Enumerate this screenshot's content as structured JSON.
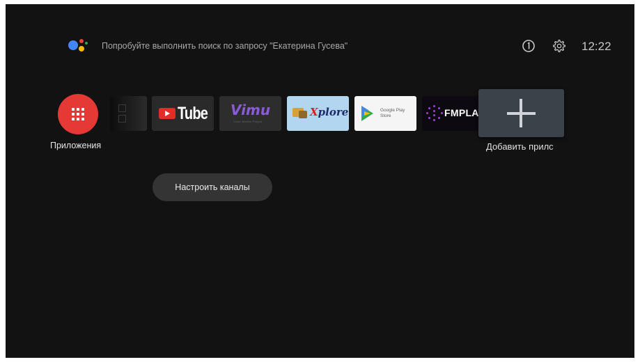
{
  "header": {
    "search_hint": "Попробуйте выполнить поиск по запросу \"Екатерина Гусева\"",
    "clock": "12:22",
    "assistant_colors": [
      "#4285f4",
      "#ea4335",
      "#fbbc05",
      "#34a853"
    ]
  },
  "apps": {
    "label": "Приложения",
    "accent": "#e53935"
  },
  "tiles": [
    {
      "id": "partial",
      "icon": "app-tile-icon"
    },
    {
      "id": "youtube",
      "text": "Tube"
    },
    {
      "id": "vimu",
      "text": "Vimu",
      "sub": "Vimu Media Player"
    },
    {
      "id": "xplore",
      "text_x": "X",
      "text_rest": "plore"
    },
    {
      "id": "play_store",
      "line1": "Google Play",
      "line2": "Store"
    },
    {
      "id": "fmplay",
      "text": "FMPLAY"
    }
  ],
  "add_app": {
    "label": "Добавить прилс"
  },
  "channels": {
    "label": "Настроить каналы"
  }
}
